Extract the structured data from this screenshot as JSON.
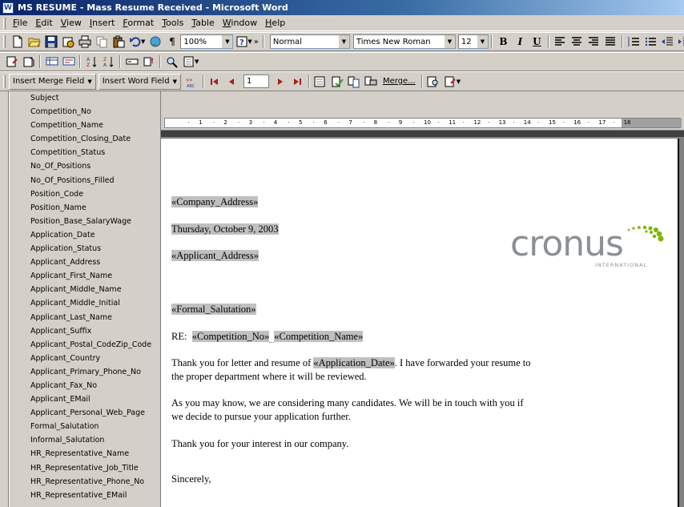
{
  "window": {
    "title": "MS RESUME - Mass Resume Received - Microsoft Word",
    "icon_label": "W"
  },
  "menu": {
    "items": [
      "File",
      "Edit",
      "View",
      "Insert",
      "Format",
      "Tools",
      "Table",
      "Window",
      "Help"
    ]
  },
  "standard_toolbar": {
    "zoom": "100%",
    "style": "Normal",
    "font": "Times New Roman",
    "font_size": "12",
    "bold": "B",
    "italic": "I",
    "underline": "U",
    "more": "»"
  },
  "mail_merge_toolbar": {
    "insert_merge_field": "Insert Merge Field",
    "insert_word_field": "Insert Word Field",
    "record_number": "1",
    "merge_label": "Merge..."
  },
  "merge_fields": [
    "Subject",
    "Competition_No",
    "Competition_Name",
    "Competition_Closing_Date",
    "Competition_Status",
    "No_Of_Positions",
    "No_Of_Positions_Filled",
    "Position_Code",
    "Position_Name",
    "Position_Base_SalaryWage",
    "Application_Date",
    "Application_Status",
    "Applicant_Address",
    "Applicant_First_Name",
    "Applicant_Middle_Name",
    "Applicant_Middle_Initial",
    "Applicant_Last_Name",
    "Applicant_Suffix",
    "Applicant_Postal_CodeZip_Code",
    "Applicant_Country",
    "Applicant_Primary_Phone_No",
    "Applicant_Fax_No",
    "Applicant_EMail",
    "Applicant_Personal_Web_Page",
    "Formal_Salutation",
    "Informal_Salutation",
    "HR_Representative_Name",
    "HR_Representative_Job_Title",
    "HR_Representative_Phone_No",
    "HR_Representative_EMail"
  ],
  "ruler": {
    "labels": [
      "1",
      "2",
      "3",
      "4",
      "5",
      "6",
      "7",
      "8",
      "9",
      "10",
      "11",
      "12",
      "13",
      "14",
      "15",
      "16",
      "17",
      "18"
    ]
  },
  "document": {
    "company_address": "«Company_Address»",
    "date": "Thursday, October 9, 2003",
    "applicant_address": "«Applicant_Address»",
    "salutation": "«Formal_Salutation»",
    "re_label": "RE:",
    "re_field1": "«Competition_No»",
    "re_field2": "«Competition_Name»",
    "para1_before": "Thank you for letter and resume of ",
    "para1_field": "«Application_Date»",
    "para1_after": ". I have forwarded your resume to",
    "para1_line2": "the proper department where it will be reviewed.",
    "para2_line1": "As you may know, we are considering many candidates. We will be in touch with you if",
    "para2_line2": "we decide to pursue your application further.",
    "para3": "Thank you for your interest in our company.",
    "closing": "Sincerely,"
  },
  "logo": {
    "wordmark": "cronus",
    "subtitle": "INTERNATIONAL",
    "color": "#8a9096",
    "accent_color": "#7ab800"
  }
}
